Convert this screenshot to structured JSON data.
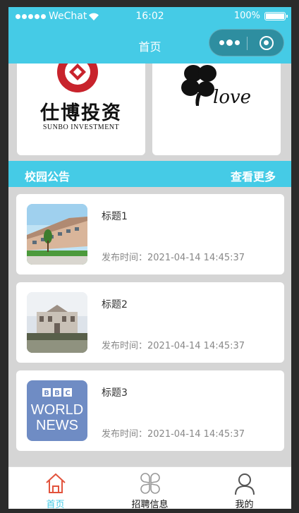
{
  "status_bar": {
    "carrier": "WeChat",
    "time": "16:02",
    "battery": "100%",
    "battery_level": 1.0
  },
  "nav": {
    "title": "首页"
  },
  "partners": [
    {
      "name": "仕博投资",
      "subtitle": "SUNBO INVESTMENT",
      "logo": "sunbo-logo"
    },
    {
      "logo": "clover-love-logo"
    }
  ],
  "section": {
    "title": "校园公告",
    "more": "查看更多"
  },
  "news": [
    {
      "title": "标题1",
      "time": "发布时间：2021-04-14 14:45:37",
      "thumb": "campus-building-photo"
    },
    {
      "title": "标题2",
      "time": "发布时间：2021-04-14 14:45:37",
      "thumb": "school-gate-photo"
    },
    {
      "title": "标题3",
      "time": "发布时间：2021-04-14 14:45:37",
      "thumb": "bbc-world-news-logo",
      "thumb_text": [
        "BBC",
        "WORLD",
        "NEWS"
      ]
    }
  ],
  "tabbar": [
    {
      "label": "首页",
      "icon": "home-icon",
      "active": true
    },
    {
      "label": "招聘信息",
      "icon": "four-petal-icon",
      "active": false
    },
    {
      "label": "我的",
      "icon": "user-icon",
      "active": false
    }
  ],
  "colors": {
    "accent": "#45cbe6",
    "background": "#d5d5d5",
    "home_tab_icon": "#e2533c"
  }
}
